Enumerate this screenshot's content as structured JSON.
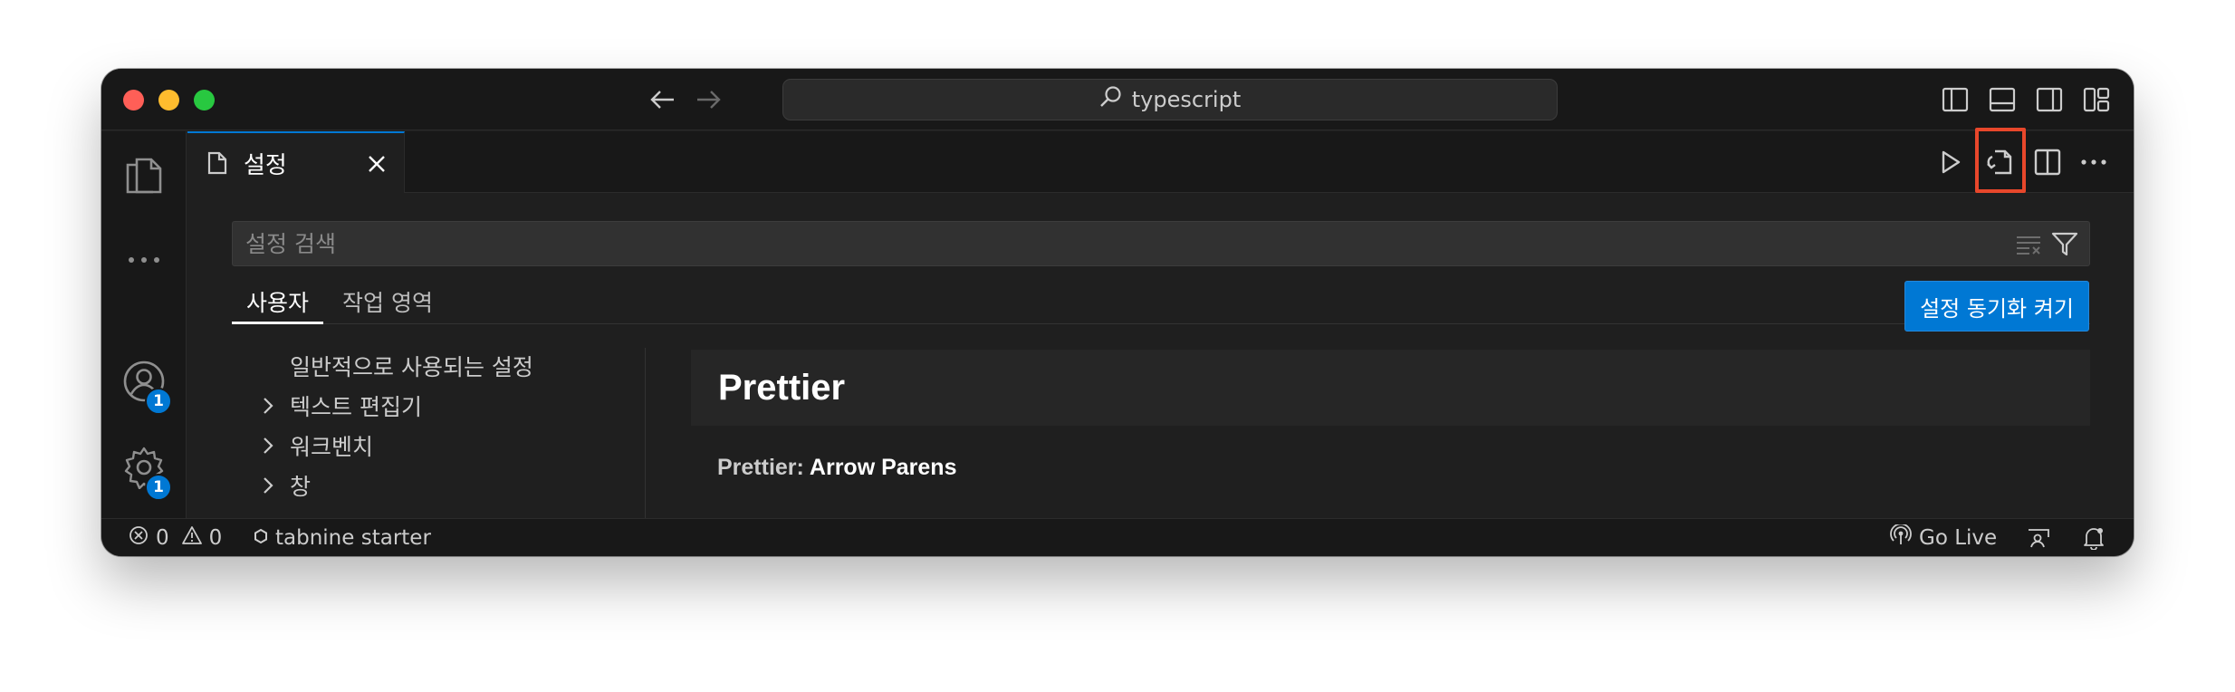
{
  "titlebar": {
    "search_text": "typescript"
  },
  "activity_bar": {
    "accounts_badge": "1",
    "manage_badge": "1"
  },
  "editor_tab": {
    "label": "설정"
  },
  "settings": {
    "search_placeholder": "설정 검색",
    "scope_tabs": [
      {
        "label": "사용자"
      },
      {
        "label": "작업 영역"
      }
    ],
    "sync_button": "설정 동기화 켜기",
    "toc": [
      {
        "label": "일반적으로 사용되는 설정",
        "expandable": false
      },
      {
        "label": "텍스트 편집기",
        "expandable": true
      },
      {
        "label": "워크벤치",
        "expandable": true
      },
      {
        "label": "창",
        "expandable": true
      }
    ],
    "section_header": "Prettier",
    "setting_category": "Prettier:",
    "setting_name": "Arrow Parens"
  },
  "statusbar": {
    "errors": "0",
    "warnings": "0",
    "tabnine": "tabnine starter",
    "go_live": "Go Live"
  },
  "colors": {
    "accent": "#0078d4",
    "highlight": "#e8472b",
    "background": "#1f1f1f"
  }
}
